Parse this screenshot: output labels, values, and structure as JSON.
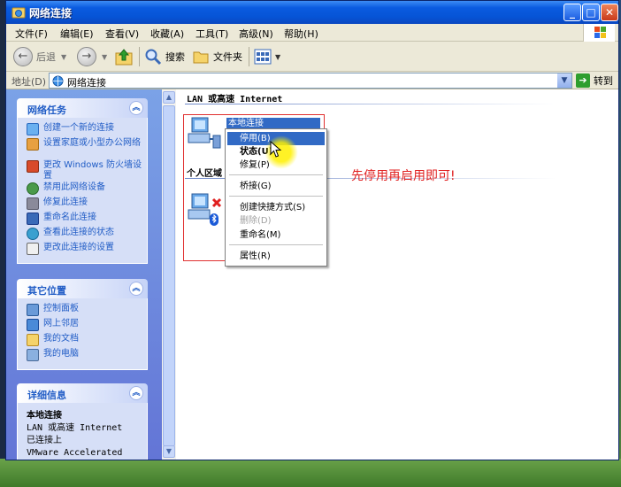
{
  "window": {
    "title": "网络连接"
  },
  "menu": [
    "文件(F)",
    "编辑(E)",
    "查看(V)",
    "收藏(A)",
    "工具(T)",
    "高级(N)",
    "帮助(H)"
  ],
  "toolbar": {
    "back": "后退",
    "search": "搜索",
    "folders": "文件夹"
  },
  "address": {
    "label": "地址(D)",
    "value": "网络连接",
    "go": "转到"
  },
  "tasks_panel": {
    "title": "网络任务",
    "items": [
      "创建一个新的连接",
      "设置家庭或小型办公网络",
      "更改 Windows 防火墙设置",
      "禁用此网络设备",
      "修复此连接",
      "重命名此连接",
      "查看此连接的状态",
      "更改此连接的设置"
    ]
  },
  "other_places": {
    "title": "其它位置",
    "items": [
      "控制面板",
      "网上邻居",
      "我的文档",
      "我的电脑"
    ]
  },
  "details": {
    "title": "详细信息",
    "name": "本地连接",
    "type": "LAN 或高速 Internet",
    "status": "已连接上",
    "adapter": "VMware Accelerated AMD"
  },
  "main": {
    "group_lan": "LAN 或高速 Internet",
    "group_personal": "个人区域",
    "connection_label": "本地连接"
  },
  "context_menu": {
    "disable": "停用(B)",
    "status": "状态(U)",
    "repair": "修复(P)",
    "bridge": "桥接(G)",
    "shortcut": "创建快捷方式(S)",
    "delete": "删除(D)",
    "rename": "重命名(M)",
    "properties": "属性(R)"
  },
  "annotation": "先停用再启用即可!",
  "colors": {
    "title_blue": "#0654d6",
    "selection": "#316ac5",
    "annotation_red": "#e02020",
    "task_link": "#215dc6"
  }
}
